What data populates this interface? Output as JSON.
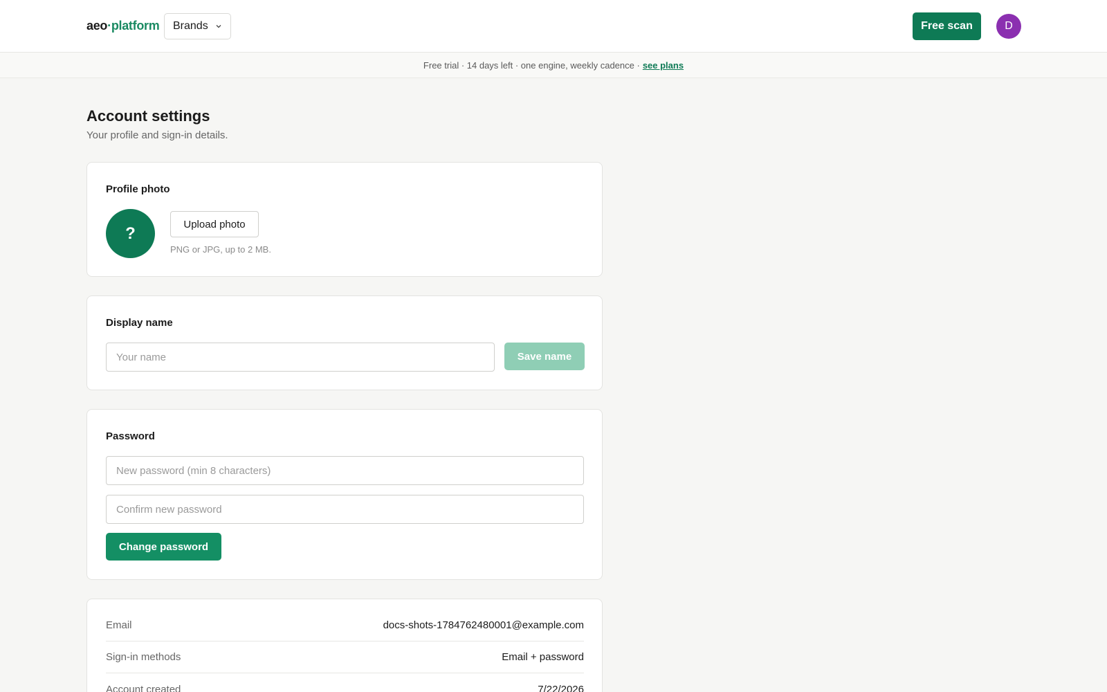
{
  "header": {
    "logo_part1": "aeo",
    "logo_dot": "·",
    "logo_part2": "platform",
    "brands_label": "Brands",
    "free_scan_label": "Free scan",
    "avatar_initial": "D"
  },
  "banner": {
    "text": "Free trial · 14 days left · one engine, weekly cadence ·",
    "link": "see plans"
  },
  "page": {
    "title": "Account settings",
    "subtitle": "Your profile and sign-in details."
  },
  "profile_photo": {
    "title": "Profile photo",
    "placeholder_glyph": "?",
    "upload_label": "Upload photo",
    "hint": "PNG or JPG, up to 2 MB."
  },
  "display_name": {
    "title": "Display name",
    "input_value": "",
    "input_placeholder": "Your name",
    "save_label": "Save name"
  },
  "password": {
    "title": "Password",
    "new_placeholder": "New password (min 8 characters)",
    "confirm_placeholder": "Confirm new password",
    "change_label": "Change password"
  },
  "account_info": {
    "rows": [
      {
        "label": "Email",
        "value": "docs-shots-1784762480001@example.com"
      },
      {
        "label": "Sign-in methods",
        "value": "Email + password"
      },
      {
        "label": "Account created",
        "value": "7/22/2026"
      }
    ]
  },
  "colors": {
    "brand_green": "#0e7a55",
    "disabled_green": "#8fceb5",
    "avatar_purple": "#8b2fb0"
  }
}
